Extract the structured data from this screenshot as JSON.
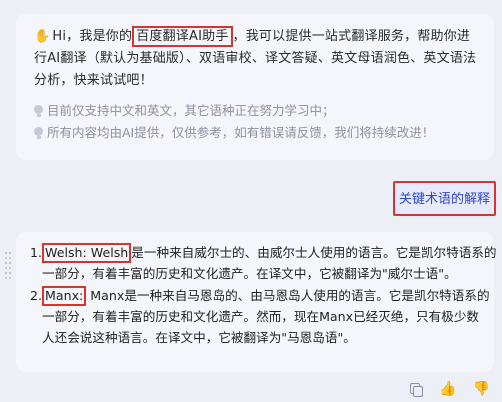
{
  "intro": {
    "greeting_before": "Hi，我是你的",
    "assistant_name": "百度翻译AI助手",
    "greeting_after": "，我可以提供一站式翻译服务，帮助你进行AI翻译（默认为基础版）、双语审校、译文答疑、英文母语润色、英文语法分析，快来试试吧！",
    "tips": [
      "目前仅支持中文和英文，其它语种正在努力学习中；",
      "所有内容均由AI提供，仅供参考，如有错误请反馈，我们将持续改进！"
    ]
  },
  "user_message": "关键术语的解释",
  "answer": {
    "items": [
      {
        "number": "1.",
        "term": "Welsh: Welsh",
        "line1_rest": "是一种来自威尔士的、由威尔士人使用的语言。它是凯尔特语系的",
        "lines": [
          "一部分，有着丰富的历史和文化遗产。在译文中，它被翻译为\"威尔士语\"。"
        ]
      },
      {
        "number": "2.",
        "term": "Manx:",
        "line1_rest": " Manx是一种来自马恩岛的、由马恩岛人使用的语言。它是凯尔特语系的",
        "lines": [
          "一部分，有着丰富的历史和文化遗产。然而，现在Manx已经灭绝，只有极少数",
          "人还会说这种语言。在译文中，它被翻译为\"马恩岛语\"。"
        ]
      }
    ]
  },
  "toolbar": {
    "icons": [
      "copy-icon",
      "thumbs-up-icon",
      "thumbs-down-icon"
    ]
  },
  "colors": {
    "highlight_border": "#d7332f",
    "user_text": "#3148c8",
    "bubble_bg": "#f5f6fb",
    "page_bg": "#eceff6"
  }
}
